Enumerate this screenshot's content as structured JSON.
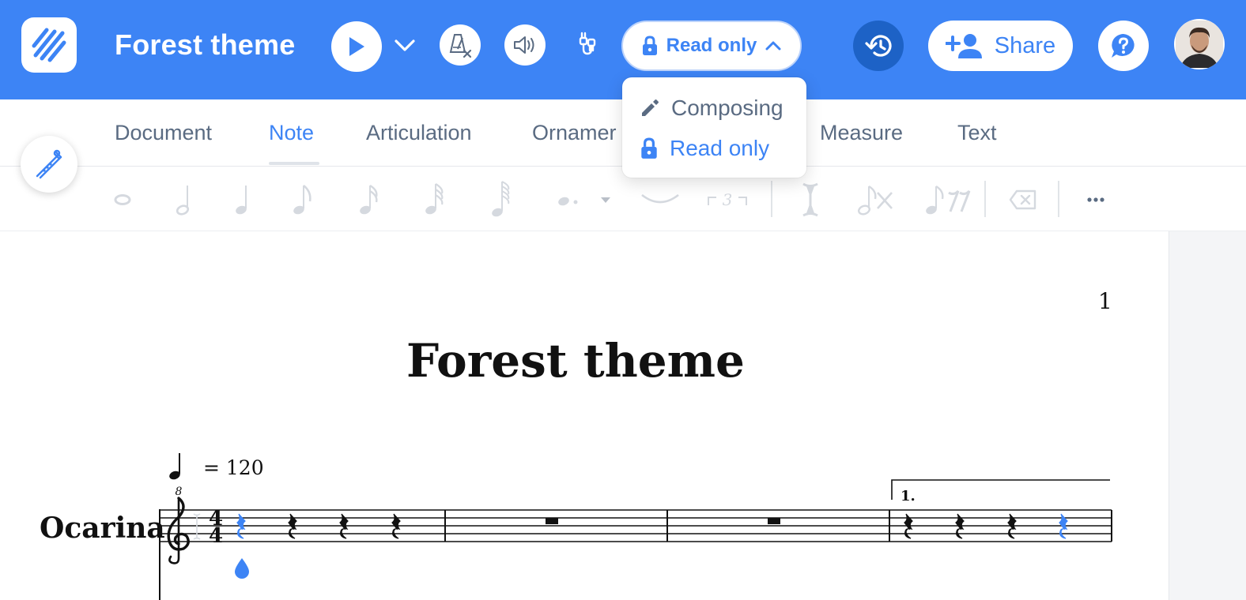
{
  "app": {
    "document_title": "Forest theme"
  },
  "header": {
    "mode_label": "Read only",
    "share_label": "Share"
  },
  "mode_menu": {
    "items": [
      {
        "label": "Composing",
        "icon": "pencil-icon",
        "selected": false
      },
      {
        "label": "Read only",
        "icon": "lock-icon",
        "selected": true
      }
    ]
  },
  "tabs": [
    {
      "label": "Document",
      "active": false
    },
    {
      "label": "Note",
      "active": true
    },
    {
      "label": "Articulation",
      "active": false
    },
    {
      "label": "Ornamer",
      "active": false
    },
    {
      "label": "Measure",
      "active": false
    },
    {
      "label": "Text",
      "active": false
    }
  ],
  "toolbar": {
    "tuplet_label": "3",
    "tools": [
      "whole-note-icon",
      "half-note-icon",
      "quarter-note-icon",
      "eighth-note-icon",
      "sixteenth-note-icon",
      "thirty-second-note-icon",
      "sixty-fourth-note-icon",
      "dot-icon",
      "dot-dropdown-icon",
      "tie-icon",
      "tuplet-icon",
      "cursor-icon",
      "remove-note-icon",
      "rest-icon",
      "delete-icon",
      "more-icon"
    ]
  },
  "score": {
    "page_number": "1",
    "title": "Forest theme",
    "tempo_text": "= 120",
    "instrument": "Ocarina",
    "time_signature_top": "4",
    "time_signature_bottom": "4",
    "clef_octave": "8",
    "volta": "1."
  },
  "colors": {
    "brand_blue": "#3d84f5",
    "history_blue": "#1d62c6",
    "muted_text": "#5a6b82",
    "disabled_icon": "#d5d9df"
  }
}
